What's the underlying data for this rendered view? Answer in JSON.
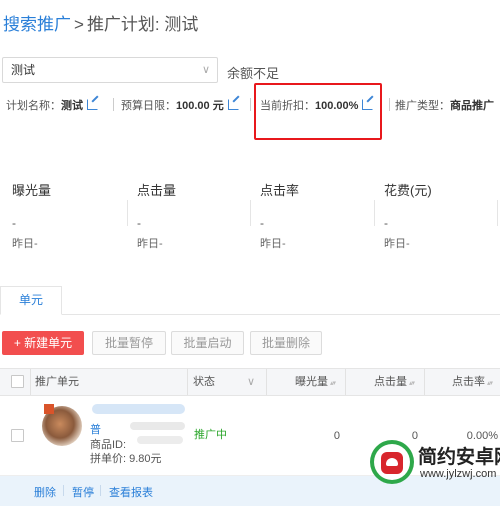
{
  "breadcrumb": {
    "root": "搜索推广",
    "separator": ">",
    "current": "推广计划: 测试"
  },
  "plan_select": {
    "value": "测试",
    "balance_tip": "余额不足"
  },
  "info": {
    "plan_name_label": "计划名称：",
    "plan_name_value": "测试",
    "budget_label": "预算日限：",
    "budget_value": "100.00 元",
    "discount_label": "当前折扣：",
    "discount_value": "100.00%",
    "type_label": "推广类型：",
    "type_value": "商品推广"
  },
  "stats": [
    {
      "label": "曝光量",
      "value": "-",
      "yesterday": "昨日-"
    },
    {
      "label": "点击量",
      "value": "-",
      "yesterday": "昨日-"
    },
    {
      "label": "点击率",
      "value": "-",
      "yesterday": "昨日-"
    },
    {
      "label": "花费(元)",
      "value": "-",
      "yesterday": "昨日-"
    }
  ],
  "tabs": {
    "active": "单元"
  },
  "toolbar": {
    "new_unit": "+ 新建单元",
    "batch_pause": "批量暂停",
    "batch_start": "批量启动",
    "batch_delete": "批量删除"
  },
  "table": {
    "headers": {
      "unit": "推广单元",
      "status": "状态",
      "impressions": "曝光量",
      "clicks": "点击量",
      "ctr": "点击率"
    },
    "rows": [
      {
        "name": "普",
        "goods_id": "商品ID: ",
        "price": "拼单价: 9.80元",
        "status": "推广中",
        "impressions": "0",
        "clicks": "0",
        "ctr": "0.00%"
      }
    ]
  },
  "row_actions": {
    "delete": "删除",
    "pause": "暂停",
    "report": "查看报表"
  },
  "watermark": {
    "title": "简约安卓网",
    "url": "www.jylzwj.com"
  },
  "colors": {
    "link": "#2a7fd8",
    "primary_button": "#f24e4e",
    "highlight_border": "#e8181c",
    "status_active": "#2aa52a"
  }
}
